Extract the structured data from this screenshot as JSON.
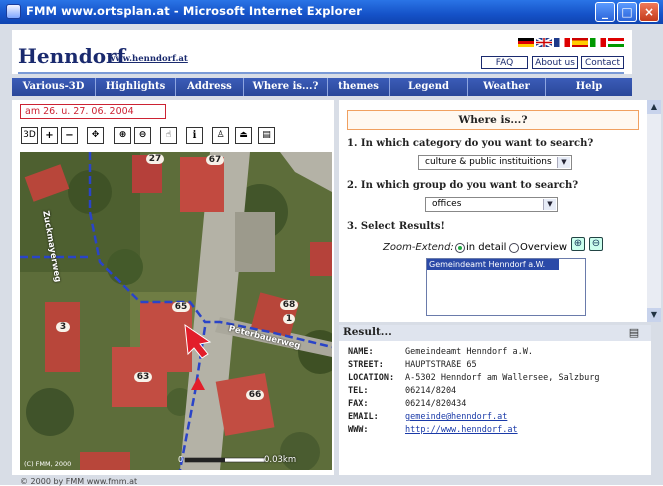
{
  "window": {
    "title": "FMM www.ortsplan.at - Microsoft Internet Explorer",
    "buttons": [
      "minimize",
      "maximize",
      "close"
    ]
  },
  "header": {
    "site_title": "Henndorf",
    "site_url": "www.henndorf.at",
    "links": [
      "FAQ",
      "About us",
      "Contact"
    ],
    "flags": [
      "de",
      "gb",
      "fr",
      "es",
      "it",
      "hu"
    ]
  },
  "nav": {
    "items": [
      "Various-3D",
      "Highlights",
      "Address",
      "Where is...?",
      "themes",
      "Legend",
      "Weather",
      "Help"
    ],
    "accent": "#2a4799"
  },
  "map_panel": {
    "date": "am 26. u. 27. 06. 2004",
    "tools": [
      "3D",
      "+",
      "−",
      "⊕",
      "🔍",
      "🔍",
      "✋",
      "i",
      "⬆",
      "⬛",
      "🖨"
    ],
    "tool_icons": [
      "3d-icon",
      "zoom-in-icon",
      "zoom-out-icon",
      "pan-icon",
      "magnify-in-icon",
      "magnify-out-icon",
      "hand-icon",
      "info-icon",
      "print-icon",
      "upload-icon",
      "printer-icon"
    ],
    "house_numbers": [
      "27",
      "67",
      "65",
      "68",
      "1",
      "3",
      "63",
      "66"
    ],
    "street_labels": [
      "Zuckmayerweg",
      "Peterbauerweg"
    ],
    "scale": "0.03km",
    "scale_zero": "0",
    "copyright": "(C) FMM, 2000"
  },
  "search": {
    "heading": "Where is...?",
    "q1": "1. In which category do you want to search?",
    "category": "culture & public instituitions",
    "q2": "2. In which group do you want to search?",
    "group": "offices",
    "q3": "3. Select Results!",
    "zoom_label": "Zoom-Extend:",
    "zoom_options": [
      "in detail",
      "Overview"
    ],
    "zoom_selected": "in detail",
    "results": [
      "Gemeindeamt Henndorf a.W."
    ]
  },
  "result": {
    "title": "Result...",
    "rows": [
      {
        "label": "NAME:",
        "value": "Gemeindeamt Henndorf a.W."
      },
      {
        "label": "STREET:",
        "value": "HAUPTSTRAßE 65"
      },
      {
        "label": "LOCATION:",
        "value": "A-5302 Henndorf am Wallersee, Salzburg"
      },
      {
        "label": "TEL:",
        "value": "06214/8204"
      },
      {
        "label": "FAX:",
        "value": "06214/820434"
      },
      {
        "label": "EMAIL:",
        "value": "gemeinde@henndorf.at"
      },
      {
        "label": "WWW:",
        "value": "http://www.henndorf.at"
      }
    ]
  },
  "footer": {
    "text": "© 2000 by FMM www.fmm.at"
  }
}
